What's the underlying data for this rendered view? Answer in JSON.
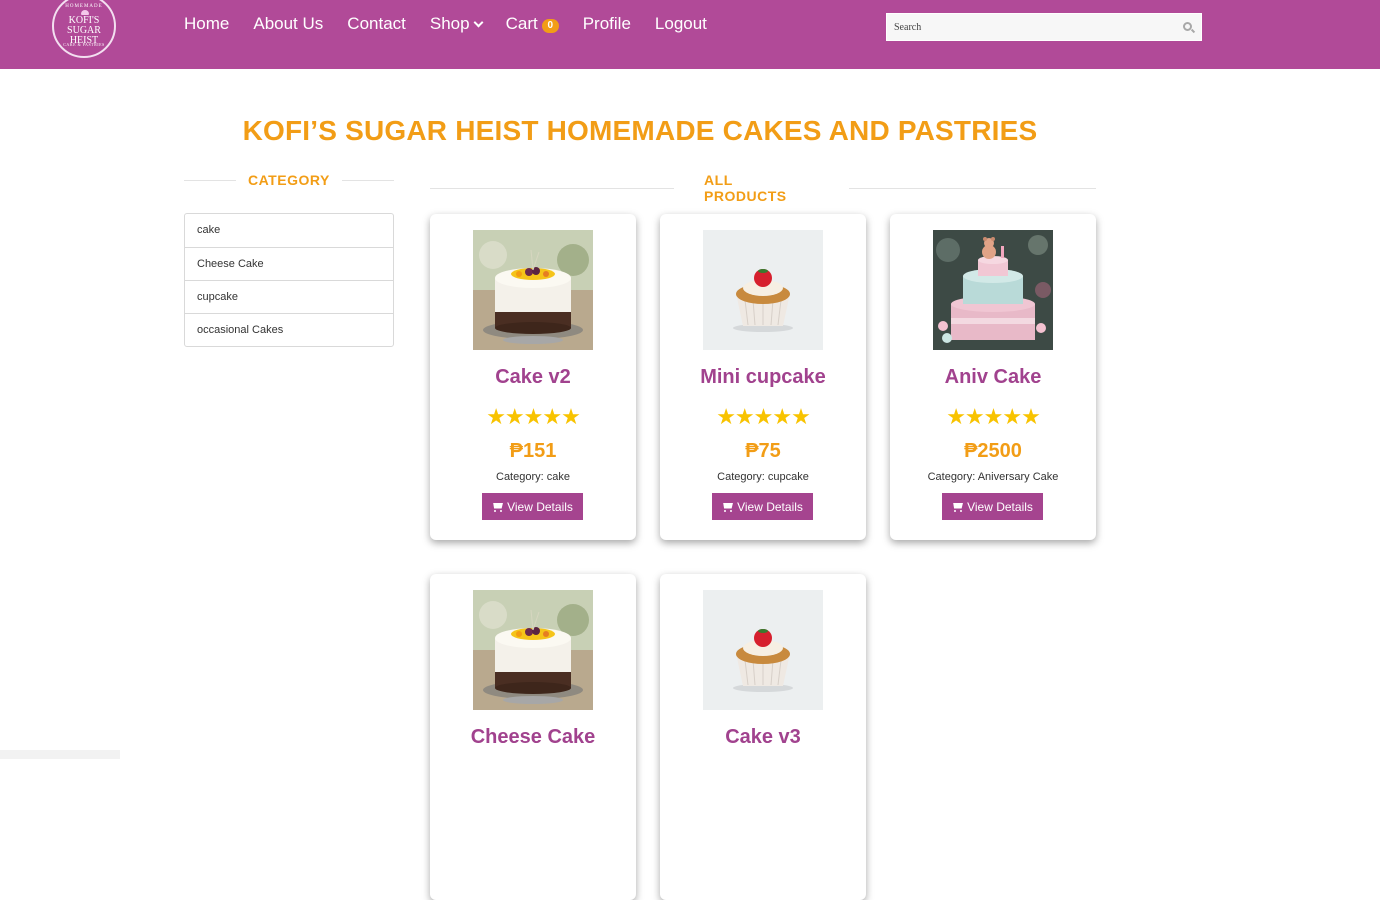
{
  "header": {
    "logo": {
      "top": "HOMEMADE",
      "name": "KOFI'S SUGAR HEIST",
      "bottom": "CAKE & PASTRIES"
    },
    "nav": [
      {
        "label": "Home"
      },
      {
        "label": "About Us"
      },
      {
        "label": "Contact"
      },
      {
        "label": "Shop"
      },
      {
        "label": "Cart",
        "badge": "0"
      },
      {
        "label": "Profile"
      },
      {
        "label": "Logout"
      }
    ],
    "search": {
      "placeholder": "Search",
      "icon": "search-icon"
    }
  },
  "page_title": "KOFI’S SUGAR HEIST HOMEMADE CAKES AND PASTRIES",
  "category_section": {
    "heading": "CATEGORY",
    "items": [
      "cake",
      "Cheese Cake",
      "cupcake",
      "occasional Cakes"
    ]
  },
  "products_section": {
    "heading": "ALL PRODUCTS",
    "products": [
      {
        "name": "Cake v2",
        "rating": 5,
        "stars": "★★★★★",
        "price": "₱151",
        "category": "Category: cake",
        "button": "View Details",
        "image": "fruit-cake"
      },
      {
        "name": "Mini cupcake",
        "rating": 5,
        "stars": "★★★★★",
        "price": "₱75",
        "category": "Category: cupcake",
        "button": "View Details",
        "image": "cupcake"
      },
      {
        "name": "Aniv Cake",
        "rating": 5,
        "stars": "★★★★★",
        "price": "₱2500",
        "category": "Category: Aniversary Cake",
        "button": "View Details",
        "image": "tiered-cake"
      },
      {
        "name": "Cheese Cake",
        "image": "fruit-cake"
      },
      {
        "name": "Cake v3",
        "image": "cupcake"
      }
    ]
  },
  "colors": {
    "header": "#b14a98",
    "accent": "#f29d16",
    "product_name": "#a1428e",
    "button": "#a5448f",
    "stars": "#f8c300"
  }
}
